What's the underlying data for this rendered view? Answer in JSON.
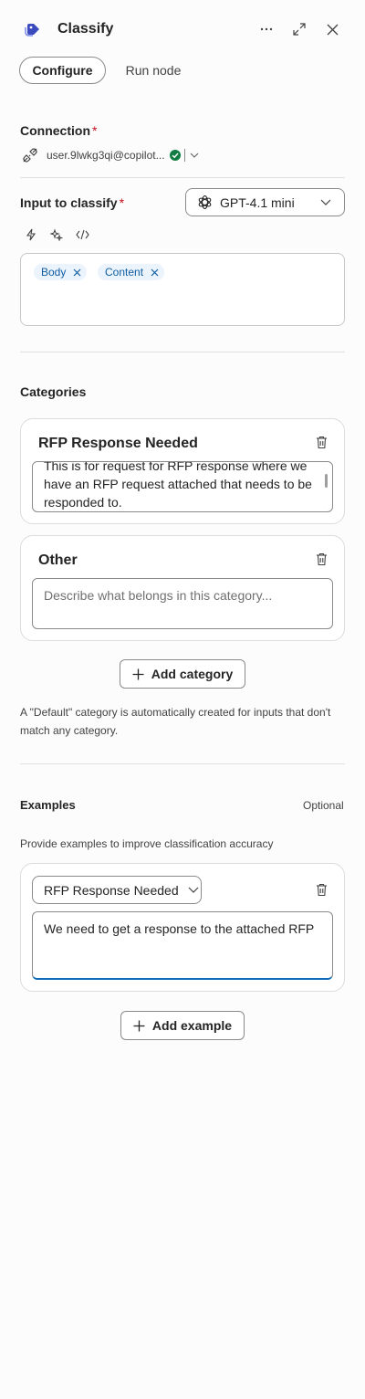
{
  "header": {
    "title": "Classify",
    "icons": [
      "tag-icon",
      "more-icon",
      "expand-icon",
      "close-icon"
    ]
  },
  "tabs": [
    {
      "label": "Configure",
      "active": true
    },
    {
      "label": "Run node",
      "active": false
    }
  ],
  "connection": {
    "label": "Connection",
    "required_mark": "*",
    "account": "user.9lwkg3qi@copilot..."
  },
  "input": {
    "label": "Input to classify",
    "required_mark": "*",
    "model": "GPT-4.1 mini",
    "chips": [
      "Body",
      "Content"
    ]
  },
  "categories": {
    "heading": "Categories",
    "items": [
      {
        "name": "RFP Response Needed",
        "description": "This is for request for RFP response where we have an RFP request attached that needs to be responded to."
      },
      {
        "name": "Other",
        "description": "",
        "placeholder": "Describe what belongs in this category..."
      }
    ],
    "add_label": "Add category",
    "note": "A \"Default\" category is automatically created for inputs that don't match any category."
  },
  "examples": {
    "heading": "Examples",
    "optional_label": "Optional",
    "description": "Provide examples to improve classification accuracy",
    "items": [
      {
        "category": "RFP Response Needed",
        "text": "We need to get a response to the attached RFP"
      }
    ],
    "add_label": "Add example"
  },
  "colors": {
    "accent": "#4f6bed",
    "chip_bg": "#ebf3fc",
    "chip_text": "#115ea3",
    "required": "#c50f1f",
    "verified": "#107c41",
    "focus_underline": "#0f6cbd"
  }
}
